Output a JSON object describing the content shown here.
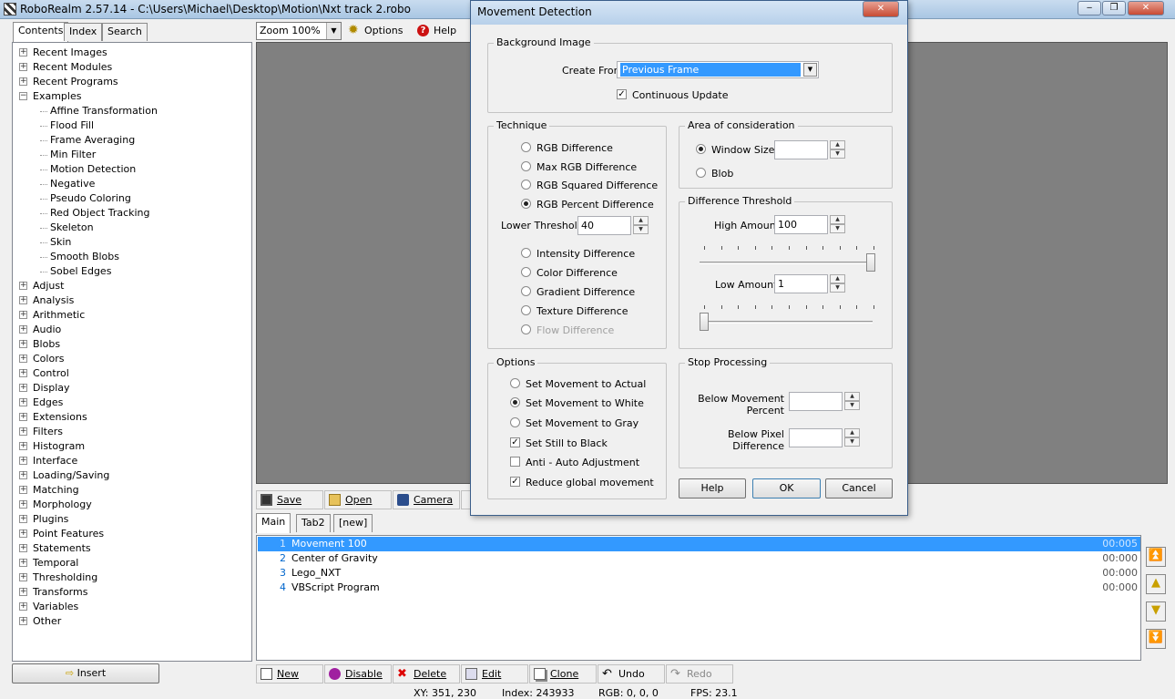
{
  "app": {
    "title": "RoboRealm 2.57.14 - C:\\Users\\Michael\\Desktop\\Motion\\Nxt track 2.robo",
    "minimize": "‒",
    "maximize": "❐",
    "close": "✕"
  },
  "left_tabs": [
    "Contents",
    "Index",
    "Search"
  ],
  "tree": [
    {
      "label": "Recent Images",
      "level": 0,
      "expander": "+"
    },
    {
      "label": "Recent Modules",
      "level": 0,
      "expander": "+"
    },
    {
      "label": "Recent Programs",
      "level": 0,
      "expander": "+"
    },
    {
      "label": "Examples",
      "level": 0,
      "expander": "−"
    },
    {
      "label": "Affine Transformation",
      "level": 1
    },
    {
      "label": "Flood Fill",
      "level": 1
    },
    {
      "label": "Frame Averaging",
      "level": 1
    },
    {
      "label": "Min Filter",
      "level": 1
    },
    {
      "label": "Motion Detection",
      "level": 1
    },
    {
      "label": "Negative",
      "level": 1
    },
    {
      "label": "Pseudo Coloring",
      "level": 1
    },
    {
      "label": "Red Object Tracking",
      "level": 1
    },
    {
      "label": "Skeleton",
      "level": 1
    },
    {
      "label": "Skin",
      "level": 1
    },
    {
      "label": "Smooth Blobs",
      "level": 1
    },
    {
      "label": "Sobel Edges",
      "level": 1
    },
    {
      "label": "Adjust",
      "level": 0,
      "expander": "+"
    },
    {
      "label": "Analysis",
      "level": 0,
      "expander": "+"
    },
    {
      "label": "Arithmetic",
      "level": 0,
      "expander": "+"
    },
    {
      "label": "Audio",
      "level": 0,
      "expander": "+"
    },
    {
      "label": "Blobs",
      "level": 0,
      "expander": "+"
    },
    {
      "label": "Colors",
      "level": 0,
      "expander": "+"
    },
    {
      "label": "Control",
      "level": 0,
      "expander": "+"
    },
    {
      "label": "Display",
      "level": 0,
      "expander": "+"
    },
    {
      "label": "Edges",
      "level": 0,
      "expander": "+"
    },
    {
      "label": "Extensions",
      "level": 0,
      "expander": "+"
    },
    {
      "label": "Filters",
      "level": 0,
      "expander": "+"
    },
    {
      "label": "Histogram",
      "level": 0,
      "expander": "+"
    },
    {
      "label": "Interface",
      "level": 0,
      "expander": "+"
    },
    {
      "label": "Loading/Saving",
      "level": 0,
      "expander": "+"
    },
    {
      "label": "Matching",
      "level": 0,
      "expander": "+"
    },
    {
      "label": "Morphology",
      "level": 0,
      "expander": "+"
    },
    {
      "label": "Plugins",
      "level": 0,
      "expander": "+"
    },
    {
      "label": "Point Features",
      "level": 0,
      "expander": "+"
    },
    {
      "label": "Statements",
      "level": 0,
      "expander": "+"
    },
    {
      "label": "Temporal",
      "level": 0,
      "expander": "+"
    },
    {
      "label": "Thresholding",
      "level": 0,
      "expander": "+"
    },
    {
      "label": "Transforms",
      "level": 0,
      "expander": "+"
    },
    {
      "label": "Variables",
      "level": 0,
      "expander": "+"
    },
    {
      "label": "Other",
      "level": 0,
      "expander": "+"
    }
  ],
  "insert_label": "Insert",
  "toolbar": {
    "zoom": "Zoom 100%",
    "options": "Options",
    "help": "Help"
  },
  "file_buttons": {
    "save": "Save",
    "open": "Open",
    "camera": "Camera"
  },
  "pipeline_tabs": [
    "Main",
    "Tab2",
    "[new]"
  ],
  "pipeline": [
    {
      "num": "1",
      "name": "Movement 100",
      "time": "00:005"
    },
    {
      "num": "2",
      "name": "Center of Gravity",
      "time": "00:000"
    },
    {
      "num": "3",
      "name": "Lego_NXT",
      "time": "00:000"
    },
    {
      "num": "4",
      "name": "VBScript Program",
      "time": "00:000"
    }
  ],
  "bottom_buttons": {
    "new": "New",
    "disable": "Disable",
    "delete": "Delete",
    "edit": "Edit",
    "clone": "Clone",
    "undo": "Undo",
    "redo": "Redo"
  },
  "status": {
    "xy": "XY: 351, 230",
    "index": "Index: 243933",
    "rgb": "RGB: 0, 0, 0",
    "fps": "FPS: 23.1"
  },
  "dialog": {
    "title": "Movement Detection",
    "background_group": "Background Image",
    "create_from_label": "Create From",
    "create_from_value": "Previous Frame",
    "continuous_update": "Continuous Update",
    "technique_group": "Technique",
    "techniques_a": [
      "RGB Difference",
      "Max RGB Difference",
      "RGB Squared Difference",
      "RGB Percent Difference"
    ],
    "lower_threshold_label": "Lower Threshold",
    "lower_threshold_value": "40",
    "techniques_b": [
      "Intensity Difference",
      "Color Difference",
      "Gradient Difference",
      "Texture Difference",
      "Flow Difference"
    ],
    "area_group": "Area of consideration",
    "window_size": "Window Size",
    "blob": "Blob",
    "diff_group": "Difference Threshold",
    "high_amount_label": "High Amount",
    "high_amount_value": "100",
    "low_amount_label": "Low Amount",
    "low_amount_value": "1",
    "options_group": "Options",
    "options": [
      "Set Movement to Actual",
      "Set Movement to White",
      "Set Movement to Gray"
    ],
    "set_still_black": "Set Still to Black",
    "anti_auto": "Anti - Auto Adjustment",
    "reduce_global": "Reduce global movement",
    "stop_group": "Stop Processing",
    "below_movement": "Below Movement",
    "percent": "Percent",
    "below_pixel": "Below Pixel",
    "difference": "Difference",
    "help": "Help",
    "ok": "OK",
    "cancel": "Cancel"
  }
}
